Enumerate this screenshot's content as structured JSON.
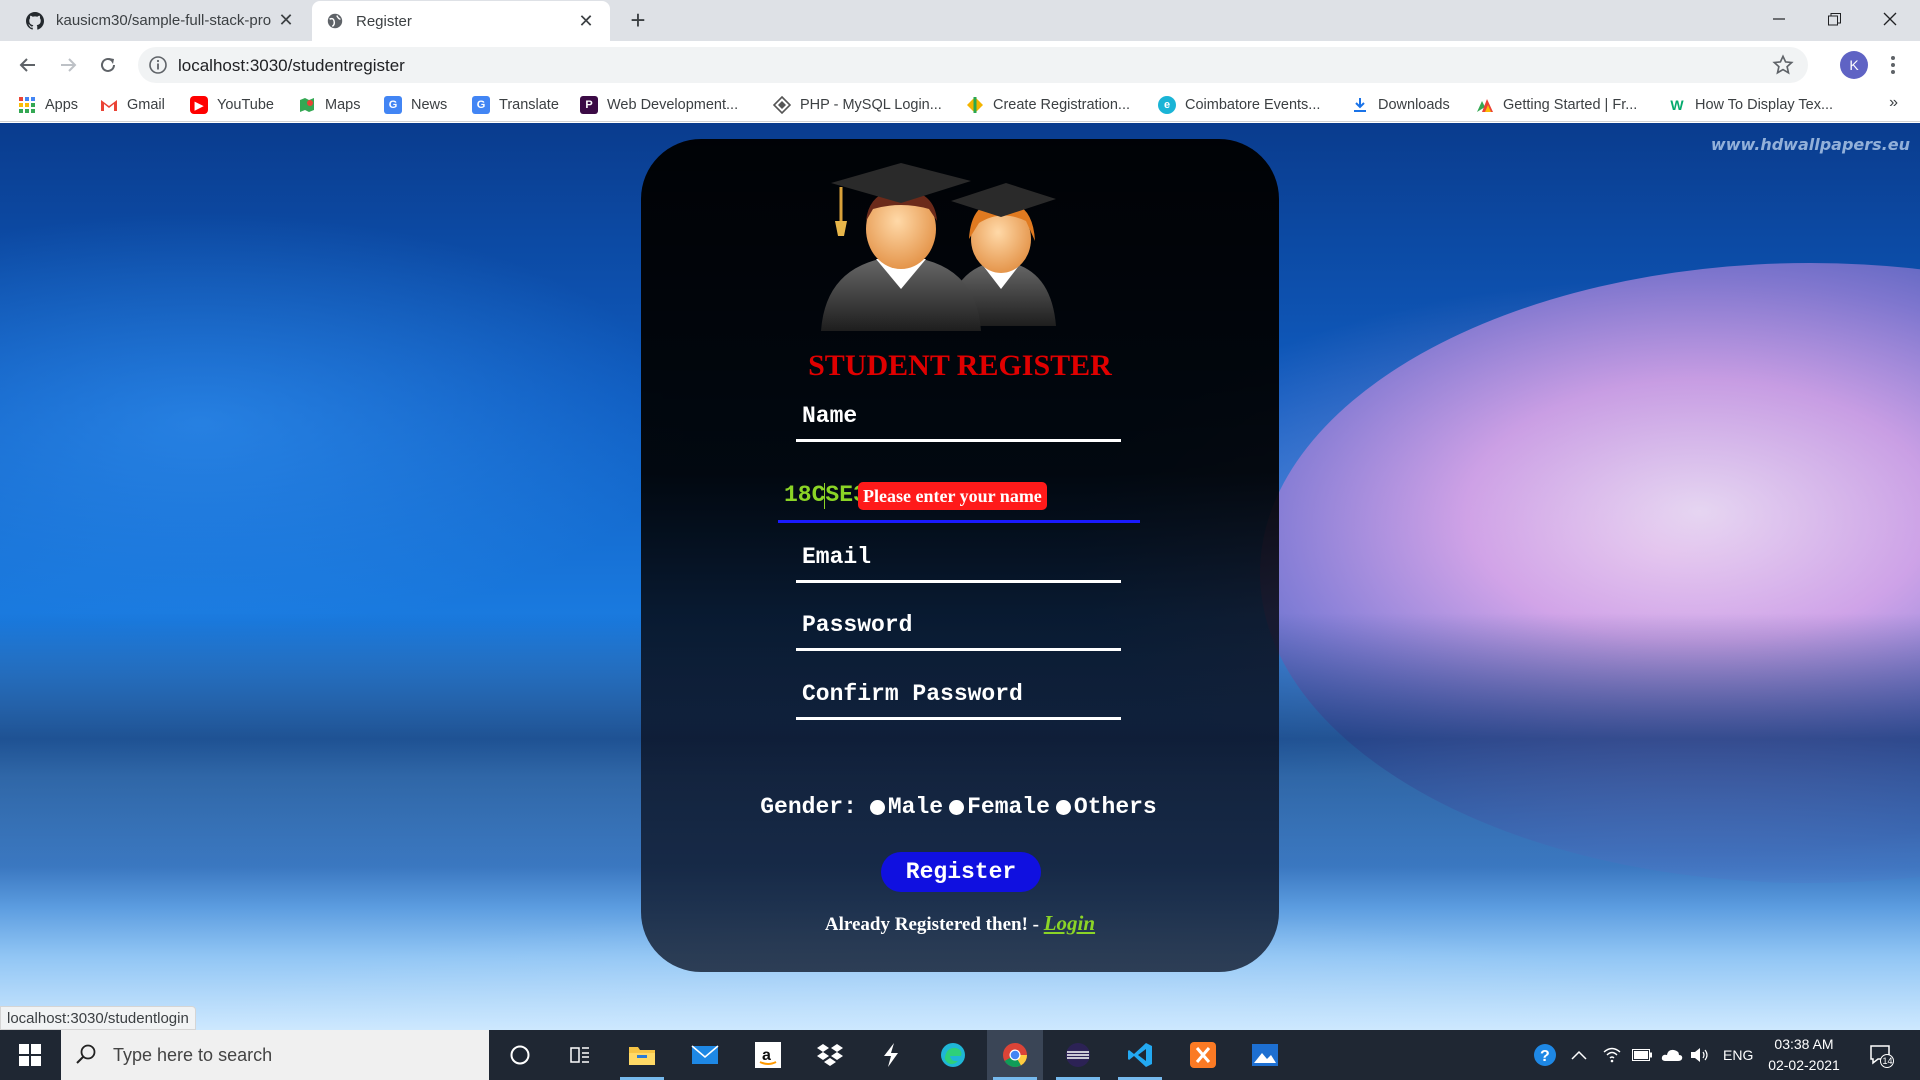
{
  "browser": {
    "tabs": [
      {
        "title": "kausicm30/sample-full-stack-pro",
        "active": false,
        "icon": "github-icon"
      },
      {
        "title": "Register",
        "active": true,
        "icon": "globe-icon"
      }
    ],
    "url": "localhost:3030/studentregister",
    "profile_initial": "K",
    "bookmarks": [
      {
        "label": "Apps",
        "icon": "apps-grid-icon",
        "color": "#4285f4"
      },
      {
        "label": "Gmail",
        "icon": "gmail-icon",
        "color": "#ea4335"
      },
      {
        "label": "YouTube",
        "icon": "youtube-icon",
        "color": "#ff0000"
      },
      {
        "label": "Maps",
        "icon": "maps-icon",
        "color": "#34a853"
      },
      {
        "label": "News",
        "icon": "news-icon",
        "color": "#4285f4"
      },
      {
        "label": "Translate",
        "icon": "translate-icon",
        "color": "#4285f4"
      },
      {
        "label": "Web Development...",
        "icon": "web-dev-icon",
        "color": "#3b0a45"
      },
      {
        "label": "PHP - MySQL Login...",
        "icon": "php-icon",
        "color": "#555555"
      },
      {
        "label": "Create Registration...",
        "icon": "registration-icon",
        "color": "#2aa84f"
      },
      {
        "label": "Coimbatore Events...",
        "icon": "events-icon",
        "color": "#1ab4d6"
      },
      {
        "label": "Downloads",
        "icon": "download-icon",
        "color": "#1a73e8"
      },
      {
        "label": "Getting Started | Fr...",
        "icon": "getting-started-icon",
        "color": "#ef6c00"
      },
      {
        "label": "How To Display Tex...",
        "icon": "w3schools-icon",
        "color": "#04aa6d"
      }
    ],
    "bookmarks_more": "»",
    "status_url": "localhost:3030/studentlogin"
  },
  "page": {
    "watermark": "www.hdwallpapers.eu",
    "title": "STUDENT REGISTER",
    "fields": {
      "name_label": "Name",
      "validation_message": "Please enter your name",
      "id_value": "18CSE30",
      "email_label": "Email",
      "password_label": "Password",
      "confirm_label": "Confirm Password"
    },
    "gender": {
      "label": "Gender:",
      "options": [
        "Male",
        "Female",
        "Others"
      ]
    },
    "register_button": "Register",
    "already_text": "Already Registered then! -",
    "login_link": "Login",
    "colors": {
      "title": "#e00000",
      "accent_green": "#8bd426",
      "button_blue": "#1010e0",
      "validation_red": "#ff1a1a"
    }
  },
  "taskbar": {
    "search_placeholder": "Type here to search",
    "language": "ENG",
    "time": "03:38 AM",
    "date": "02-02-2021",
    "notification_count": "14"
  }
}
